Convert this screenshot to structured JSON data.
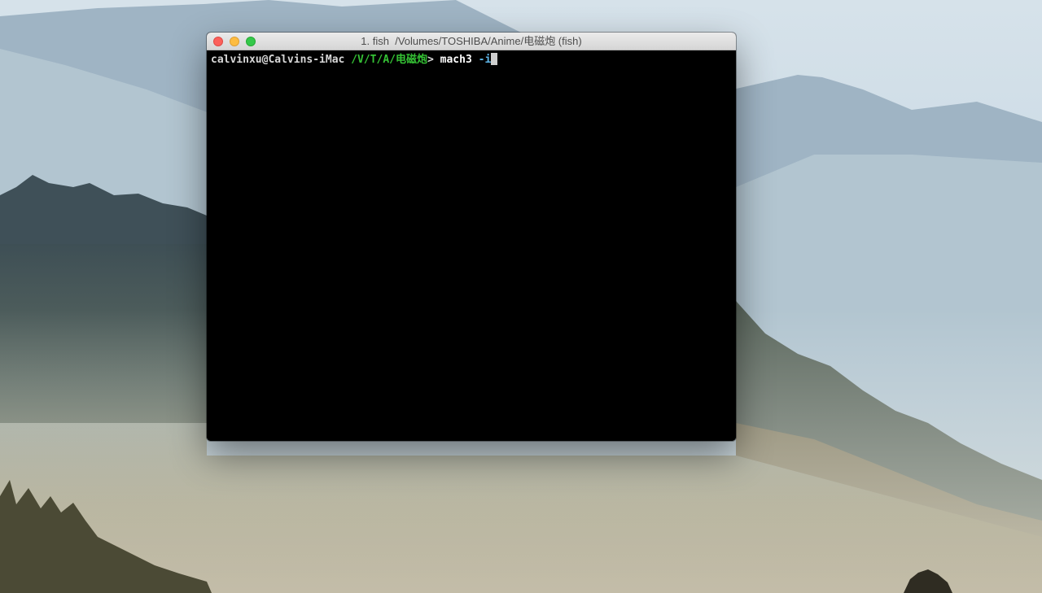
{
  "window": {
    "title": "1. fish  /Volumes/TOSHIBA/Anime/电磁炮 (fish)"
  },
  "terminal": {
    "prompt_user": "calvinxu@Calvins-iMac",
    "prompt_cwd": "/V/T/A/电磁炮",
    "prompt_symbol": ">",
    "command": "mach3",
    "argument": "-i"
  },
  "colors": {
    "terminal_background": "#000000",
    "prompt_cwd": "#35c235",
    "argument": "#5fb6e8",
    "close_button": "#fc605b",
    "minimize_button": "#fdbc40",
    "zoom_button": "#34c84a"
  },
  "icons": {
    "close": "close-icon",
    "minimize": "minimize-icon",
    "zoom": "zoom-icon"
  }
}
